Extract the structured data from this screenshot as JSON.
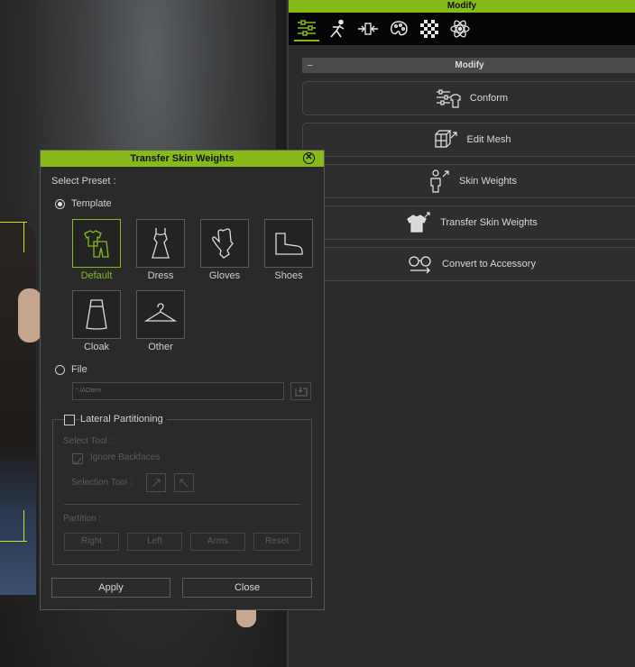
{
  "panel": {
    "title": "Modify",
    "toolbar": [
      "sliders-icon",
      "pose-icon",
      "morph-icon",
      "palette-icon",
      "checker-icon",
      "atom-icon"
    ],
    "section": {
      "label": "Modify",
      "collapse": "–"
    },
    "buttons": [
      {
        "label": "Conform",
        "icon": "conform-icon"
      },
      {
        "label": "Edit Mesh",
        "icon": "edit-mesh-icon"
      },
      {
        "label": "Skin Weights",
        "icon": "skin-weights-icon"
      },
      {
        "label": "Transfer Skin Weights",
        "icon": "shirt-icon"
      },
      {
        "label": "Convert to Accessory",
        "icon": "glasses-icon"
      }
    ]
  },
  "dialog": {
    "title": "Transfer Skin Weights",
    "select_preset": "Select Preset :",
    "template_label": "Template",
    "presets": [
      {
        "label": "Default",
        "selected": true
      },
      {
        "label": "Dress",
        "selected": false
      },
      {
        "label": "Gloves",
        "selected": false
      },
      {
        "label": "Shoes",
        "selected": false
      },
      {
        "label": "Cloak",
        "selected": false
      },
      {
        "label": "Other",
        "selected": false
      }
    ],
    "file_label": "File",
    "file_placeholder": "*.iAOtem",
    "lateral_label": "Lateral Partitioning",
    "select_tool": "Select Tool :",
    "ignore_backfaces": "Ignore Backfaces",
    "selection_tool": "Selection Tool :",
    "partition": "Partition :",
    "partition_buttons": [
      "Right",
      "Left",
      "Arms",
      "Reset"
    ],
    "apply": "Apply",
    "close": "Close"
  },
  "colors": {
    "accent": "#86b91a",
    "panel_bg": "#2b2b2b"
  }
}
